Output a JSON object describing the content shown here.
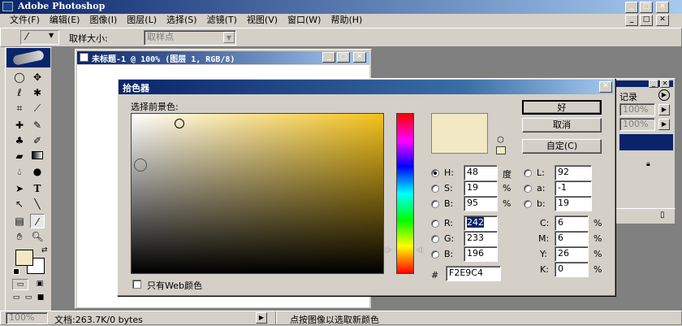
{
  "app": {
    "title": "Adobe Photoshop",
    "menu": [
      "文件(F)",
      "编辑(E)",
      "图像(I)",
      "图层(L)",
      "选择(S)",
      "滤镜(T)",
      "视图(V)",
      "窗口(W)",
      "帮助(H)"
    ]
  },
  "options_bar": {
    "sample_size_label": "取样大小:",
    "sample_size_value": "取样点"
  },
  "document": {
    "title": "未标题-1 @ 100% (图层 1, RGB/8)"
  },
  "history_panel": {
    "title_fragment": "记录",
    "opacity1": "100%",
    "opacity2": "100%"
  },
  "status_bar": {
    "zoom": "100%",
    "doc_info": "文档:263.7K/0 bytes",
    "hint": "点按图像以选取新颜色"
  },
  "color_picker": {
    "title": "拾色器",
    "select_label": "选择前景色:",
    "ok_label": "好",
    "cancel_label": "取消",
    "custom_label": "自定(C)",
    "web_only_label": "只有Web颜色",
    "selected_color": "#F2E9C4",
    "hsb": [
      {
        "label": "H:",
        "value": "48",
        "unit": "度"
      },
      {
        "label": "S:",
        "value": "19",
        "unit": "%"
      },
      {
        "label": "B:",
        "value": "95",
        "unit": "%"
      }
    ],
    "lab": [
      {
        "label": "L:",
        "value": "92"
      },
      {
        "label": "a:",
        "value": "-1"
      },
      {
        "label": "b:",
        "value": "19"
      }
    ],
    "rgb": [
      {
        "label": "R:",
        "value": "242"
      },
      {
        "label": "G:",
        "value": "233"
      },
      {
        "label": "B:",
        "value": "196"
      }
    ],
    "cmyk": [
      {
        "label": "C:",
        "value": "6",
        "unit": "%"
      },
      {
        "label": "M:",
        "value": "6",
        "unit": "%"
      },
      {
        "label": "Y:",
        "value": "26",
        "unit": "%"
      },
      {
        "label": "K:",
        "value": "0",
        "unit": "%"
      }
    ],
    "hex_label": "#",
    "hex_value": "F2E9C4"
  }
}
